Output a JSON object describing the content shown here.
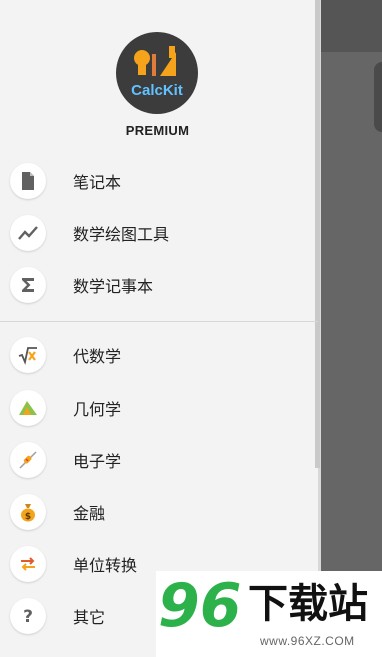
{
  "logo": {
    "app_name": "CalcKit",
    "badge_text": "PREMIUM"
  },
  "nav_group_1": [
    {
      "label": "笔记本",
      "icon": "document-icon"
    },
    {
      "label": "数学绘图工具",
      "icon": "line-chart-icon"
    },
    {
      "label": "数学记事本",
      "icon": "sigma-icon"
    }
  ],
  "nav_group_2": [
    {
      "label": "代数学",
      "icon": "square-root-icon"
    },
    {
      "label": "几何学",
      "icon": "triangle-icon"
    },
    {
      "label": "电子学",
      "icon": "resistor-icon"
    },
    {
      "label": "金融",
      "icon": "money-bag-icon"
    },
    {
      "label": "单位转换",
      "icon": "convert-arrows-icon"
    },
    {
      "label": "其它",
      "icon": "question-icon"
    }
  ],
  "watermark": {
    "number": "96",
    "site_name": "下载站",
    "url": "www.96XZ.COM"
  },
  "colors": {
    "drawer_bg": "#f3f3f3",
    "scrim": "#666666",
    "logo_accent": "#62c1ff",
    "icon_orange": "#f4a31a",
    "watermark_green": "#2db24b"
  }
}
